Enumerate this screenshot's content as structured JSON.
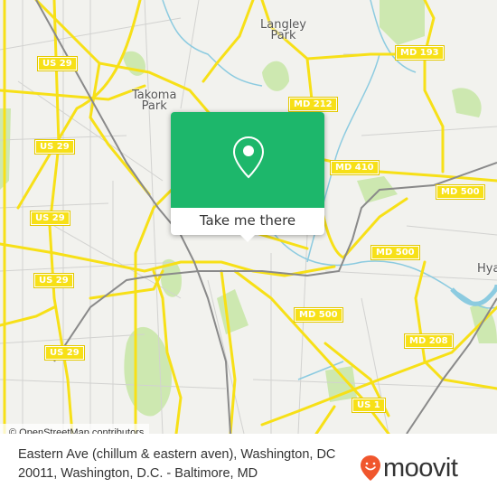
{
  "map": {
    "colors": {
      "background": "#f2f2ee",
      "road": "#f7e017",
      "rail": "#8a8a8a",
      "water": "#8ccbe0",
      "park": "#cde8b0",
      "minor_road": "#cccccc"
    },
    "places": [
      {
        "name": "Langley\nPark",
        "line1": "Langley",
        "line2": "Park"
      },
      {
        "name": "Takoma\nPark",
        "line1": "Takoma",
        "line2": "Park"
      },
      {
        "name": "Hya",
        "line1": "Hya"
      }
    ],
    "shields": [
      {
        "label": "US 29"
      },
      {
        "label": "US 29"
      },
      {
        "label": "US 29"
      },
      {
        "label": "US 29"
      },
      {
        "label": "US 29"
      },
      {
        "label": "US 29"
      },
      {
        "label": "MD 193"
      },
      {
        "label": "MD 212"
      },
      {
        "label": "MD 410"
      },
      {
        "label": "MD 500"
      },
      {
        "label": "MD 500"
      },
      {
        "label": "MD 500"
      },
      {
        "label": "MD 208"
      },
      {
        "label": "US 1"
      }
    ],
    "attribution": "© OpenStreetMap contributors"
  },
  "popup": {
    "icon": "map-pin-icon",
    "button_label": "Take me there",
    "color": "#1db76b"
  },
  "footer": {
    "address": "Eastern Ave (chillum & eastern aven), Washington, DC 20011, Washington, D.C. - Baltimore, MD",
    "logo_text": "moovit",
    "logo_icon": "moovit-pin-icon",
    "logo_color": "#f0562d"
  }
}
